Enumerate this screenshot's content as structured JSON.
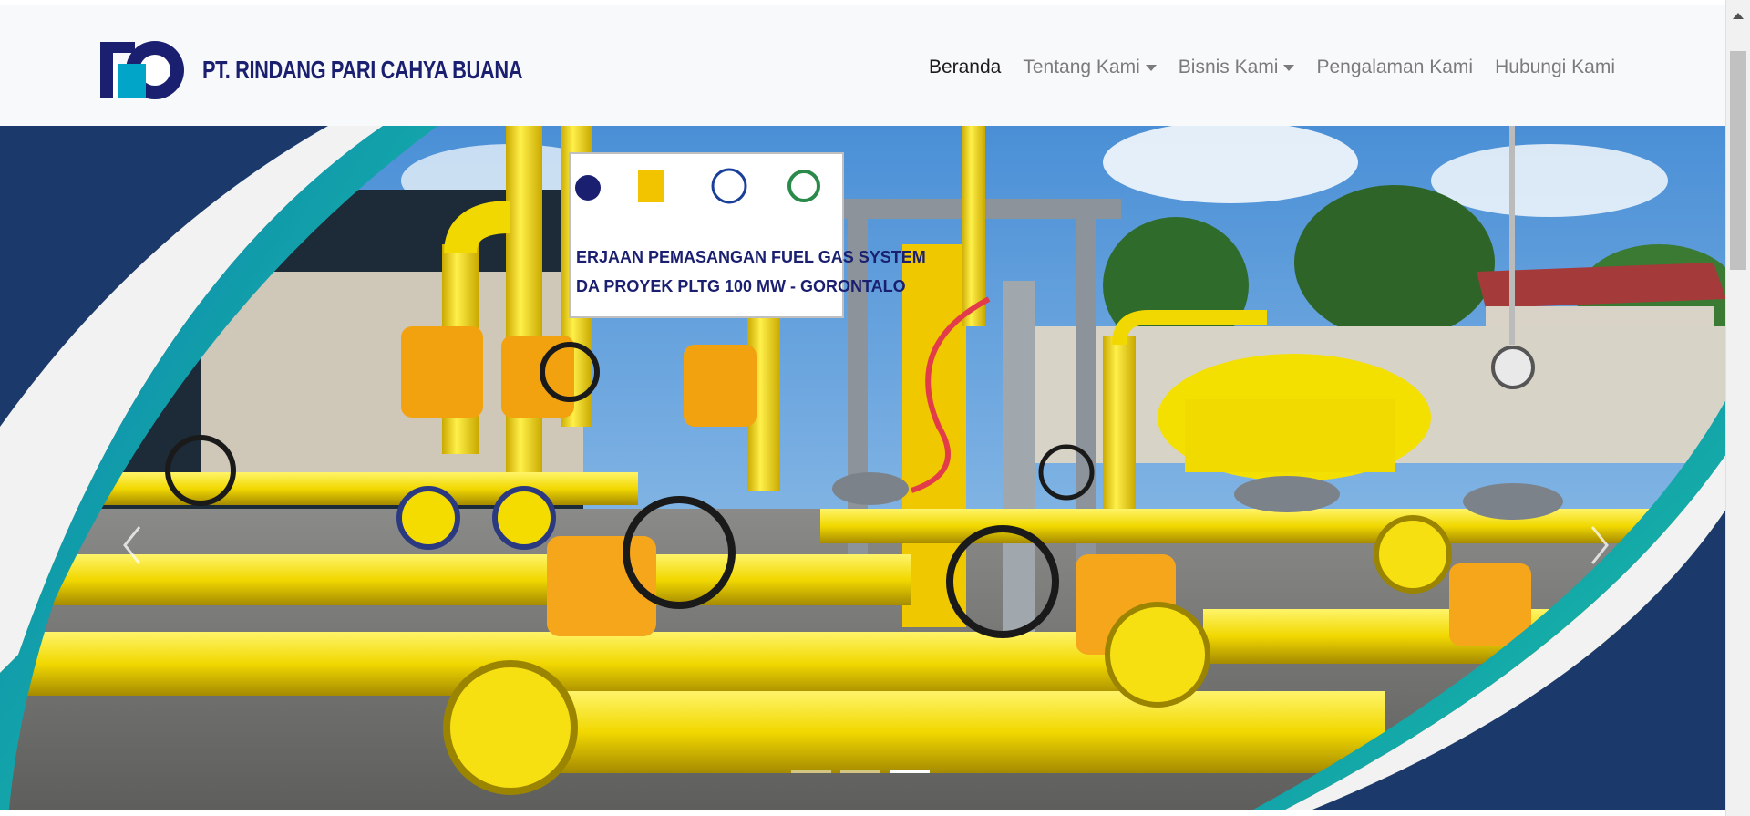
{
  "brand": {
    "name": "PT. RINDANG PARI CAHYA BUANA",
    "logo_icon": "rpcb-logo-icon",
    "colors": {
      "primary": "#1a1f70",
      "accent": "#00a5c8"
    }
  },
  "nav": {
    "items": [
      {
        "label": "Beranda",
        "active": true,
        "dropdown": false
      },
      {
        "label": "Tentang Kami",
        "active": false,
        "dropdown": true
      },
      {
        "label": "Bisnis Kami",
        "active": false,
        "dropdown": true
      },
      {
        "label": "Pengalaman Kami",
        "active": false,
        "dropdown": false
      },
      {
        "label": "Hubungi Kami",
        "active": false,
        "dropdown": false
      }
    ]
  },
  "carousel": {
    "banner": {
      "line1": "ERJAAN PEMASANGAN FUEL GAS SYSTEM",
      "line2": "DA PROYEK PLTG 100 MW - GORONTALO"
    },
    "prev_icon": "chevron-left-icon",
    "next_icon": "chevron-right-icon",
    "slide_count": 3,
    "active_slide": 3,
    "colors": {
      "frame": "#1b3a6b",
      "teal": "#0a93b0",
      "green": "#19c4a0",
      "pipe": "#f7e012"
    }
  }
}
